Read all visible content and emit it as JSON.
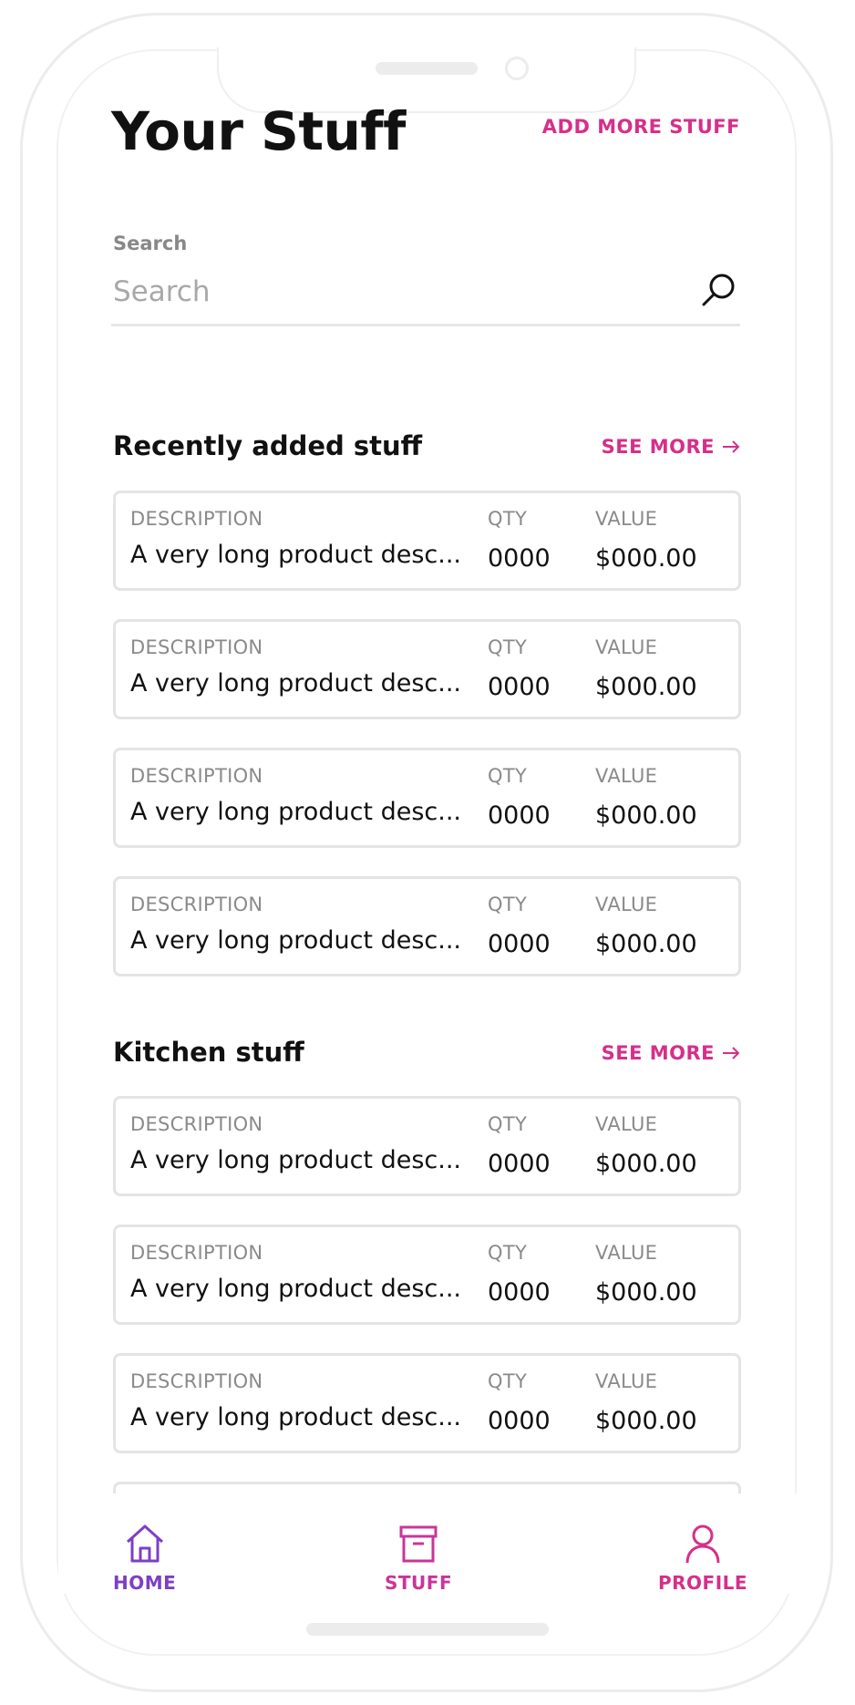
{
  "header": {
    "title": "Your Stuff",
    "add_more_label": "ADD MORE STUFF"
  },
  "search": {
    "label": "Search",
    "placeholder": "Search",
    "value": ""
  },
  "sections": [
    {
      "title": "Recently added stuff",
      "see_more_label": "SEE MORE",
      "items": [
        {
          "description_label": "DESCRIPTION",
          "description": "A very long product desc...",
          "qty_label": "QTY",
          "qty": "0000",
          "value_label": "VALUE",
          "value": "$000.00"
        },
        {
          "description_label": "DESCRIPTION",
          "description": "A very long product desc...",
          "qty_label": "QTY",
          "qty": "0000",
          "value_label": "VALUE",
          "value": "$000.00"
        },
        {
          "description_label": "DESCRIPTION",
          "description": "A very long product desc...",
          "qty_label": "QTY",
          "qty": "0000",
          "value_label": "VALUE",
          "value": "$000.00"
        },
        {
          "description_label": "DESCRIPTION",
          "description": "A very long product desc...",
          "qty_label": "QTY",
          "qty": "0000",
          "value_label": "VALUE",
          "value": "$000.00"
        }
      ]
    },
    {
      "title": "Kitchen stuff",
      "see_more_label": "SEE MORE",
      "items": [
        {
          "description_label": "DESCRIPTION",
          "description": "A very long product desc...",
          "qty_label": "QTY",
          "qty": "0000",
          "value_label": "VALUE",
          "value": "$000.00"
        },
        {
          "description_label": "DESCRIPTION",
          "description": "A very long product desc...",
          "qty_label": "QTY",
          "qty": "0000",
          "value_label": "VALUE",
          "value": "$000.00"
        },
        {
          "description_label": "DESCRIPTION",
          "description": "A very long product desc...",
          "qty_label": "QTY",
          "qty": "0000",
          "value_label": "VALUE",
          "value": "$000.00"
        }
      ]
    }
  ],
  "bottom_nav": {
    "home_label": "HOME",
    "stuff_label": "STUFF",
    "profile_label": "PROFILE",
    "home_icon": "home-icon",
    "stuff_icon": "archive-box-icon",
    "profile_icon": "user-icon"
  },
  "colors": {
    "accent_pink": "#d62f8a",
    "home_purple": "#7d3fc6",
    "stuff_magenta": "#c9359a",
    "label_gray": "#888888"
  }
}
